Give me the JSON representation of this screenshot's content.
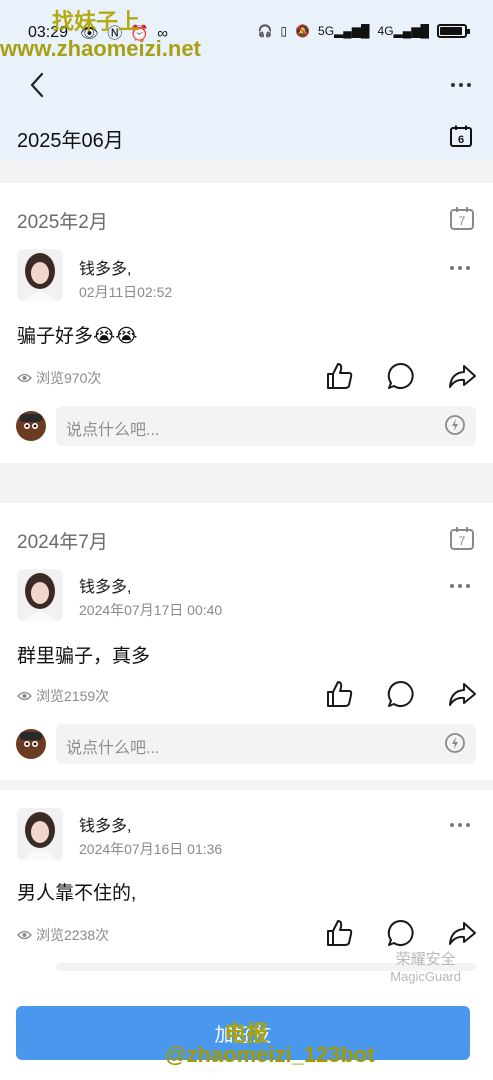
{
  "status_bar": {
    "time": "03:29",
    "left_icons": [
      "eye-icon",
      "nfc-icon",
      "alarm-icon",
      "link-icon"
    ],
    "right_icons": [
      "headphones-icon",
      "vibrate-icon",
      "mute-icon",
      "signal-5g-icon",
      "signal-4g-icon",
      "battery-icon"
    ],
    "net1": "5G",
    "net2": "4G",
    "battery_level": 0.9
  },
  "watermark": {
    "top_line1": "找妹子上",
    "top_line2": "www.zhaomeizi.net",
    "bottom_line1": "电报",
    "bottom_line2": "@zhaomeizi_123bot"
  },
  "header": {
    "month": "2025年06月",
    "calendar_day": "6"
  },
  "posts": [
    {
      "group_date": "2025年2月",
      "calendar_day": "7",
      "author": "钱多多,",
      "time": "02月11日02:52",
      "content": "骗子好多😭😭",
      "views": "浏览970次",
      "comment_placeholder": "说点什么吧..."
    },
    {
      "group_date": "2024年7月",
      "calendar_day": "7",
      "author": "钱多多,",
      "time": "2024年07月17日 00:40",
      "content": "群里骗子，真多",
      "views": "浏览2159次",
      "comment_placeholder": "说点什么吧..."
    },
    {
      "author": "钱多多,",
      "time": "2024年07月16日 01:36",
      "content": "男人靠不住的,",
      "views": "浏览2238次"
    }
  ],
  "overlay": {
    "guard_line1": "荣耀安全",
    "guard_line2": "MagicGuard"
  },
  "bottom_button": {
    "label": "加好友"
  }
}
